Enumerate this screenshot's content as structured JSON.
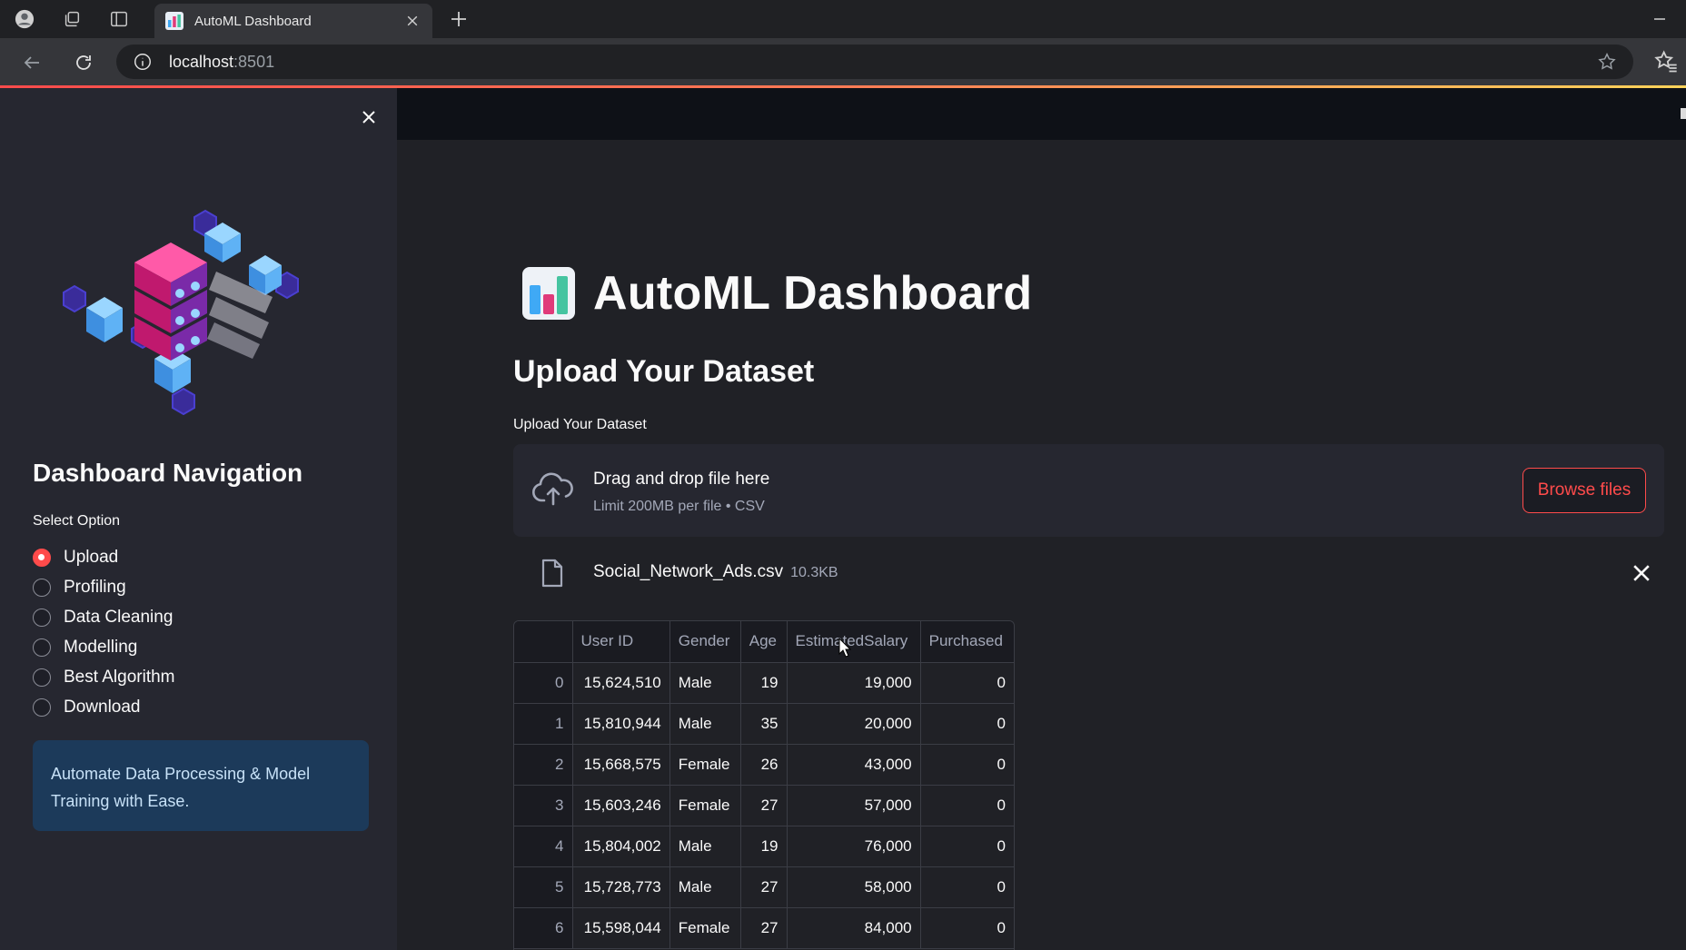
{
  "browser": {
    "tab_title": "AutoML Dashboard",
    "url_host": "localhost",
    "url_port": ":8501"
  },
  "sidebar": {
    "title": "Dashboard Navigation",
    "select_label": "Select Option",
    "options": [
      {
        "label": "Upload",
        "selected": true
      },
      {
        "label": "Profiling",
        "selected": false
      },
      {
        "label": "Data Cleaning",
        "selected": false
      },
      {
        "label": "Modelling",
        "selected": false
      },
      {
        "label": "Best Algorithm",
        "selected": false
      },
      {
        "label": "Download",
        "selected": false
      }
    ],
    "info_text": "Automate Data Processing & Model Training with Ease."
  },
  "main": {
    "title": "AutoML Dashboard",
    "subheader": "Upload Your Dataset",
    "uploader": {
      "label": "Upload Your Dataset",
      "drag_text": "Drag and drop file here",
      "limit_text": "Limit 200MB per file • CSV",
      "browse_label": "Browse files"
    },
    "file": {
      "name": "Social_Network_Ads.csv",
      "size": "10.3KB"
    },
    "table": {
      "columns": [
        "",
        "User ID",
        "Gender",
        "Age",
        "EstimatedSalary",
        "Purchased"
      ],
      "rows": [
        [
          "0",
          "15,624,510",
          "Male",
          "19",
          "19,000",
          "0"
        ],
        [
          "1",
          "15,810,944",
          "Male",
          "35",
          "20,000",
          "0"
        ],
        [
          "2",
          "15,668,575",
          "Female",
          "26",
          "43,000",
          "0"
        ],
        [
          "3",
          "15,603,246",
          "Female",
          "27",
          "57,000",
          "0"
        ],
        [
          "4",
          "15,804,002",
          "Male",
          "19",
          "76,000",
          "0"
        ],
        [
          "5",
          "15,728,773",
          "Male",
          "27",
          "58,000",
          "0"
        ],
        [
          "6",
          "15,598,044",
          "Female",
          "27",
          "84,000",
          "0"
        ]
      ]
    }
  },
  "colors": {
    "accent": "#ff4b4b",
    "sidebar_bg": "#262730",
    "main_bg": "#202126",
    "info_bg": "#1c3a5a"
  }
}
